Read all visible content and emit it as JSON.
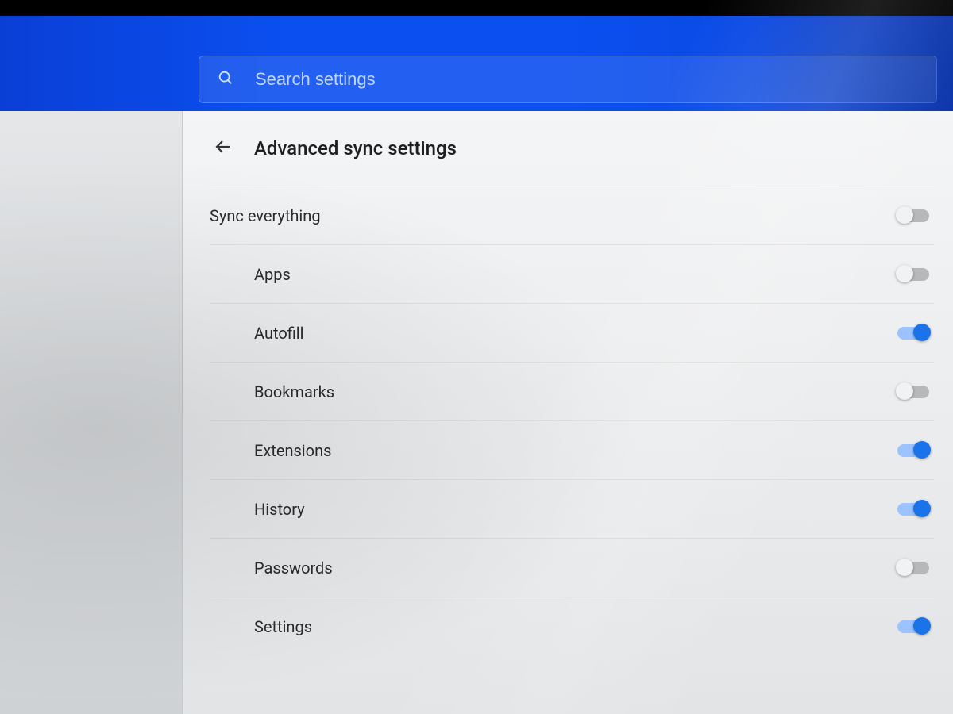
{
  "header": {
    "search_placeholder": "Search settings"
  },
  "page": {
    "title": "Advanced sync settings"
  },
  "sync": {
    "master": {
      "label": "Sync everything",
      "on": false
    },
    "items": [
      {
        "label": "Apps",
        "on": false
      },
      {
        "label": "Autofill",
        "on": true
      },
      {
        "label": "Bookmarks",
        "on": false
      },
      {
        "label": "Extensions",
        "on": true
      },
      {
        "label": "History",
        "on": true
      },
      {
        "label": "Passwords",
        "on": false
      },
      {
        "label": "Settings",
        "on": true
      }
    ]
  }
}
